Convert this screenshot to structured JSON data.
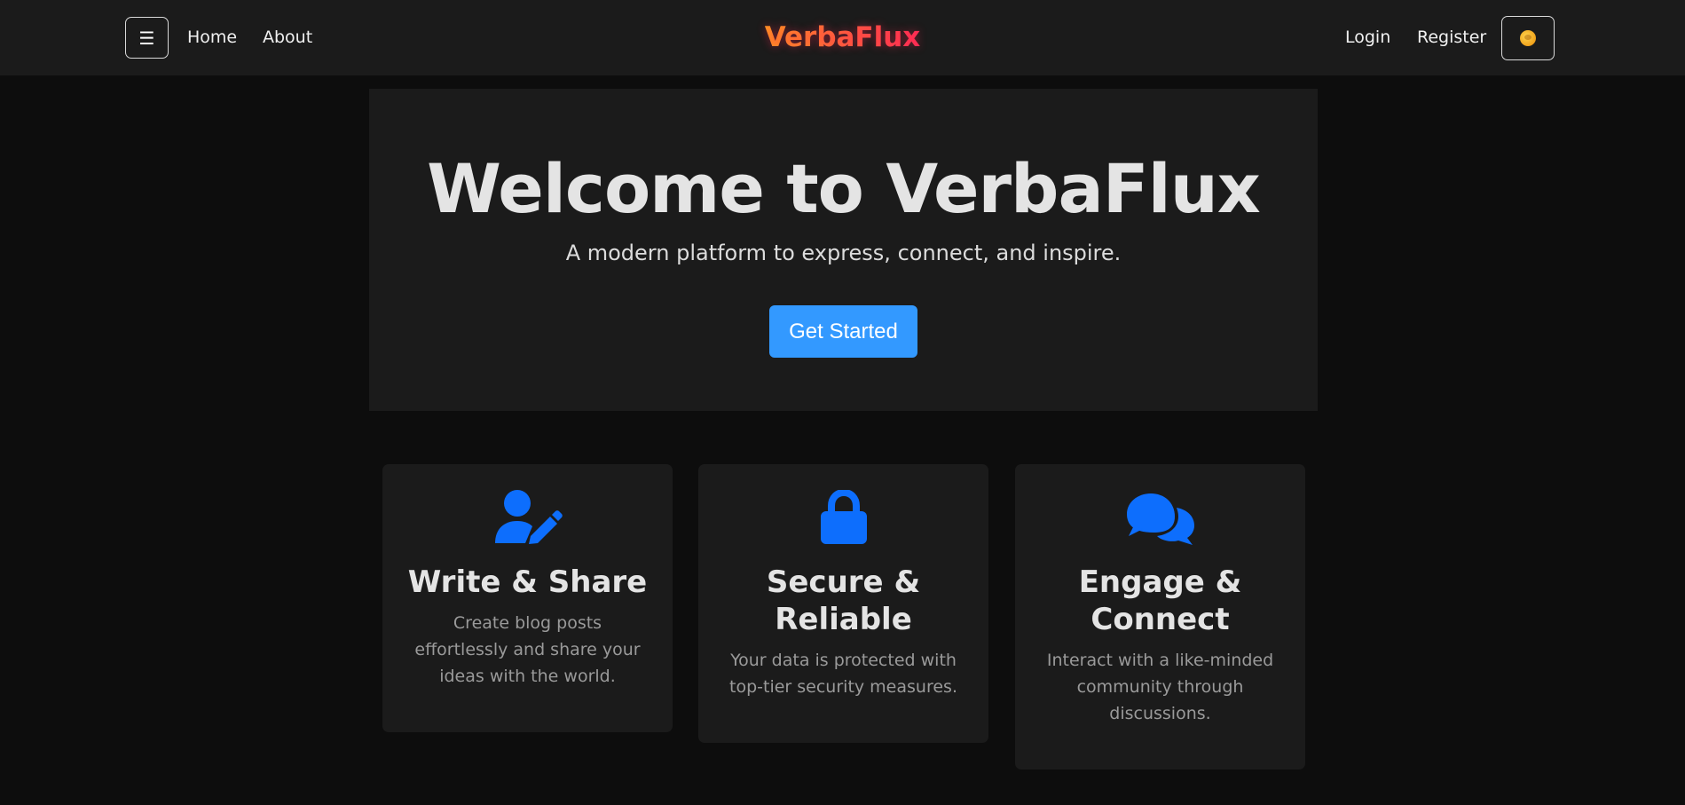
{
  "navbar": {
    "menu_icon": "☰",
    "links_left": [
      "Home",
      "About"
    ],
    "brand": "VerbaFlux",
    "links_right": [
      "Login",
      "Register"
    ],
    "theme_icon": "sun-emoji-icon"
  },
  "hero": {
    "title": "Welcome to VerbaFlux",
    "subtitle": "A modern platform to express, connect, and inspire.",
    "cta_label": "Get Started"
  },
  "features": [
    {
      "icon": "user-pen-icon",
      "title": "Write & Share",
      "text": "Create blog posts effortlessly and share your ideas with the world."
    },
    {
      "icon": "lock-icon",
      "title": "Secure & Reliable",
      "text": "Your data is protected with top-tier security measures."
    },
    {
      "icon": "comments-icon",
      "title": "Engage & Connect",
      "text": "Interact with a like-minded community through discussions."
    }
  ],
  "colors": {
    "accent": "#3399ff",
    "icon_blue": "#0d6efd",
    "brand_gradient_start": "#ff9a1f",
    "brand_gradient_end": "#ff2d55"
  }
}
